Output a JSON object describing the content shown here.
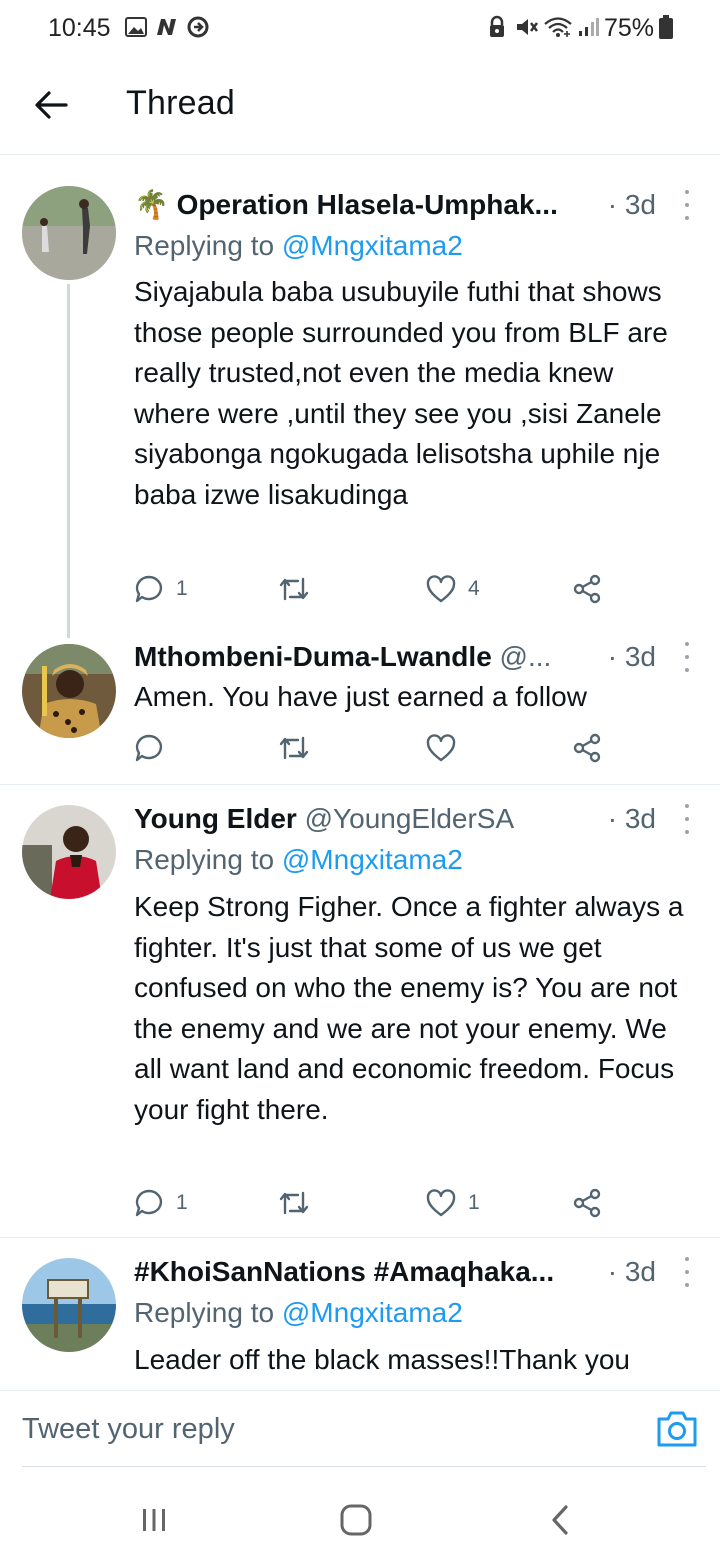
{
  "status_bar": {
    "time": "10:45",
    "battery": "75%",
    "left_icons": [
      "image-icon",
      "n-notification-icon",
      "vpn-icon"
    ],
    "right_icons": [
      "lock-icon",
      "mute-icon",
      "wifi-icon",
      "signal-icon",
      "battery-icon"
    ]
  },
  "header": {
    "title": "Thread",
    "back_icon": "arrow-left-icon"
  },
  "tweets": [
    {
      "name": "Operation Hlasela-Umphak...",
      "emoji": "🌴",
      "handle": "",
      "time": "· 3d",
      "replying_prefix": "Replying to ",
      "replying_to": "@Mngxitama2",
      "text": "Siyajabula baba usubuyile futhi that shows those people surrounded you from BLF are really trusted,not even the media knew where were ,until they see you ,sisi Zanele siyabonga ngokugada lelisotsha uphile nje baba izwe lisakudinga",
      "replies": "1",
      "retweets": "",
      "likes": "4"
    },
    {
      "name": "Mthombeni-Duma-Lwandle",
      "emoji": "",
      "handle": "@...",
      "time": "· 3d",
      "replying_prefix": "",
      "replying_to": "",
      "text": "Amen. You have just earned a follow",
      "replies": "",
      "retweets": "",
      "likes": ""
    },
    {
      "name": "Young Elder",
      "emoji": "",
      "handle": "@YoungElderSA",
      "time": "· 3d",
      "replying_prefix": "Replying to ",
      "replying_to": "@Mngxitama2",
      "text": "Keep Strong Figher. Once a fighter always a fighter. It's just that some of us we get confused on who the enemy is? You are not the enemy and we are not your enemy. We all want land and economic freedom. Focus your fight there.",
      "replies": "1",
      "retweets": "",
      "likes": "1"
    },
    {
      "name": "#KhoiSanNations #Amaqhaka...",
      "emoji": "",
      "handle": "",
      "time": "· 3d",
      "replying_prefix": "Replying to ",
      "replying_to": "@Mngxitama2",
      "text": "Leader off the black masses!!Thank you",
      "replies": "",
      "retweets": "",
      "likes": ""
    }
  ],
  "reply_bar": {
    "placeholder": "Tweet your reply",
    "camera_icon": "camera-icon"
  },
  "nav_bar": {
    "icons": [
      "recent-apps-icon",
      "home-icon",
      "back-icon"
    ]
  },
  "colors": {
    "link": "#1d9bf0",
    "secondary_text": "#536471",
    "divider": "#e6ecf0"
  }
}
